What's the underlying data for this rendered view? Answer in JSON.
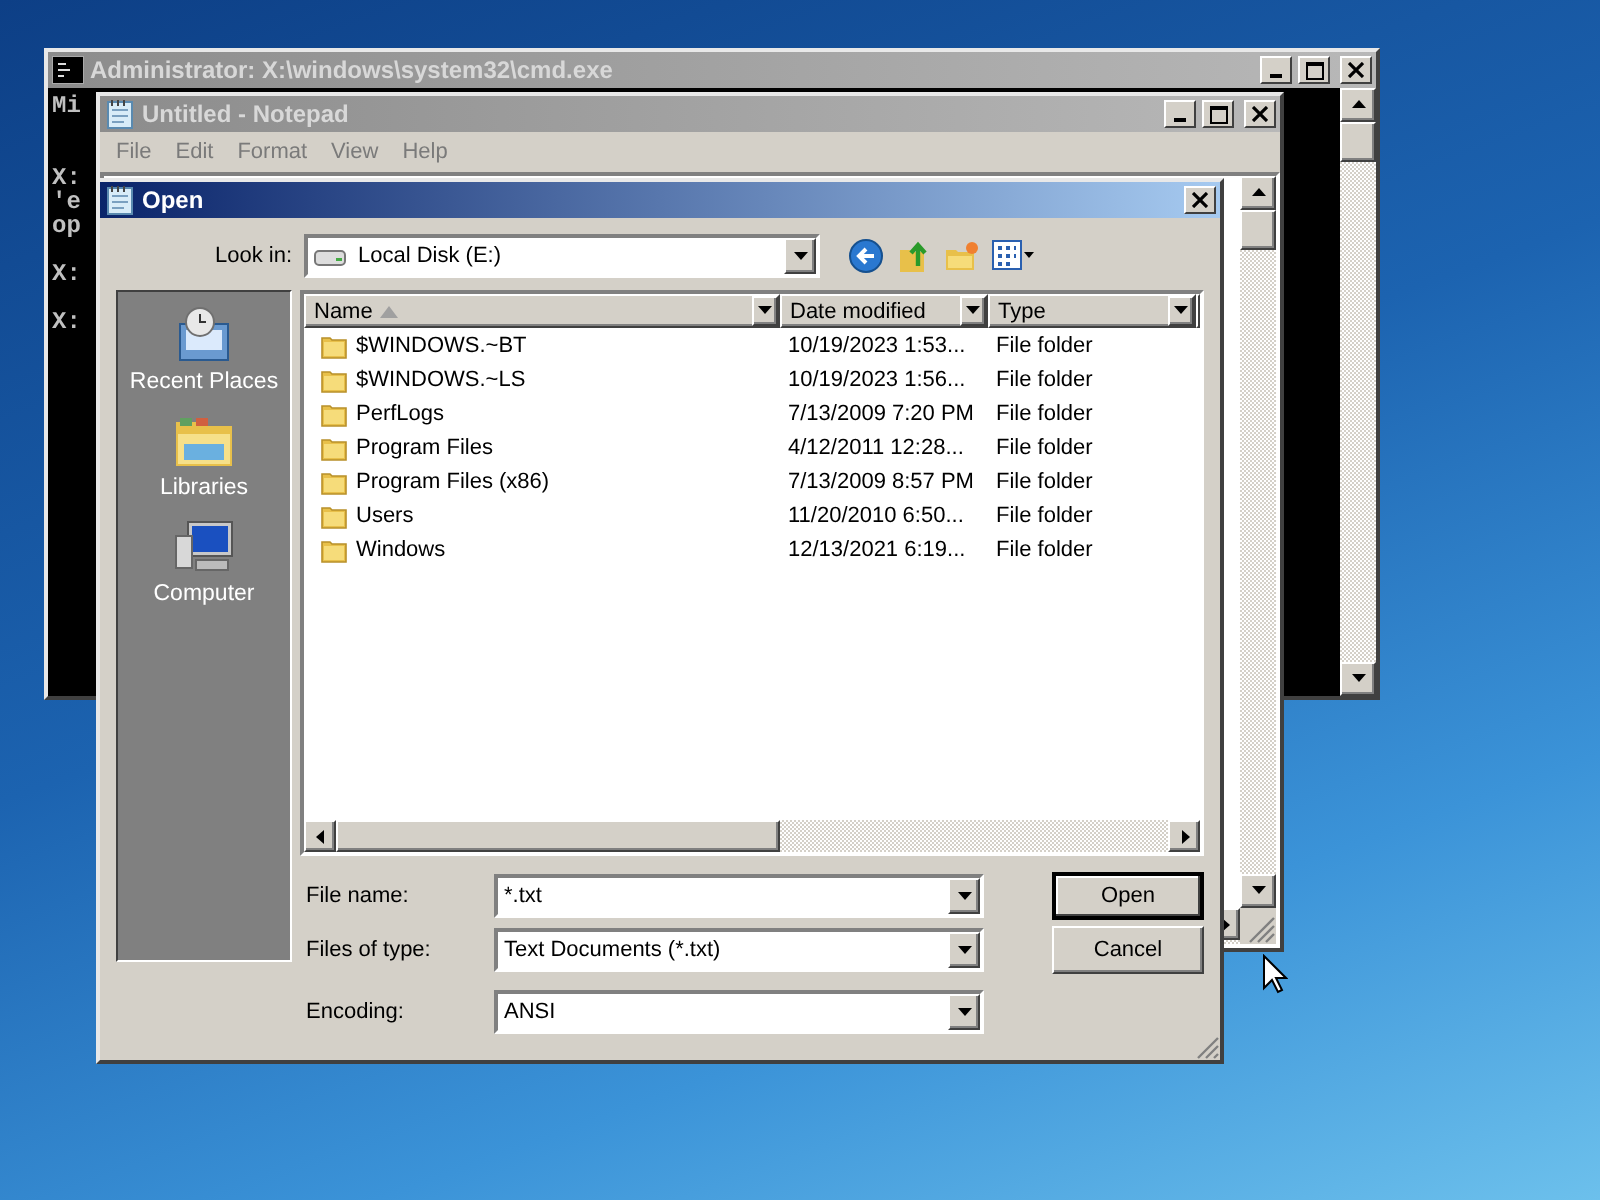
{
  "console_window": {
    "title": "Administrator: X:\\windows\\system32\\cmd.exe",
    "active": false,
    "line_groups": [
      [
        "Mi"
      ],
      [
        "X:",
        "'e",
        "op"
      ],
      [
        "X:"
      ],
      [
        "X:"
      ]
    ]
  },
  "notepad_window": {
    "title": "Untitled - Notepad",
    "active": false,
    "menu": [
      "File",
      "Edit",
      "Format",
      "View",
      "Help"
    ]
  },
  "open_dialog": {
    "title": "Open",
    "active": true,
    "look_in": {
      "label": "Look in:",
      "value": "Local Disk (E:)"
    },
    "places": [
      {
        "label": "Recent Places",
        "kind": "recent"
      },
      {
        "label": "Libraries",
        "kind": "libraries"
      },
      {
        "label": "Computer",
        "kind": "computer"
      }
    ],
    "columns": [
      {
        "label": "Name",
        "sorted": true
      },
      {
        "label": "Date modified",
        "sorted": false
      },
      {
        "label": "Type",
        "sorted": false
      }
    ],
    "rows": [
      {
        "name": "$WINDOWS.~BT",
        "date_modified": "10/19/2023 1:53...",
        "type": "File folder"
      },
      {
        "name": "$WINDOWS.~LS",
        "date_modified": "10/19/2023 1:56...",
        "type": "File folder"
      },
      {
        "name": "PerfLogs",
        "date_modified": "7/13/2009 7:20 PM",
        "type": "File folder"
      },
      {
        "name": "Program Files",
        "date_modified": "4/12/2011 12:28...",
        "type": "File folder"
      },
      {
        "name": "Program Files (x86)",
        "date_modified": "7/13/2009 8:57 PM",
        "type": "File folder"
      },
      {
        "name": "Users",
        "date_modified": "11/20/2010 6:50...",
        "type": "File folder"
      },
      {
        "name": "Windows",
        "date_modified": "12/13/2021 6:19...",
        "type": "File folder"
      }
    ],
    "fields": [
      {
        "label": "File name:",
        "value": "*.txt"
      },
      {
        "label": "Files of type:",
        "value": "Text Documents (*.txt)"
      },
      {
        "label": "Encoding:",
        "value": "ANSI"
      }
    ],
    "buttons": [
      {
        "label": "Open",
        "default": true
      },
      {
        "label": "Cancel",
        "default": false
      }
    ]
  }
}
